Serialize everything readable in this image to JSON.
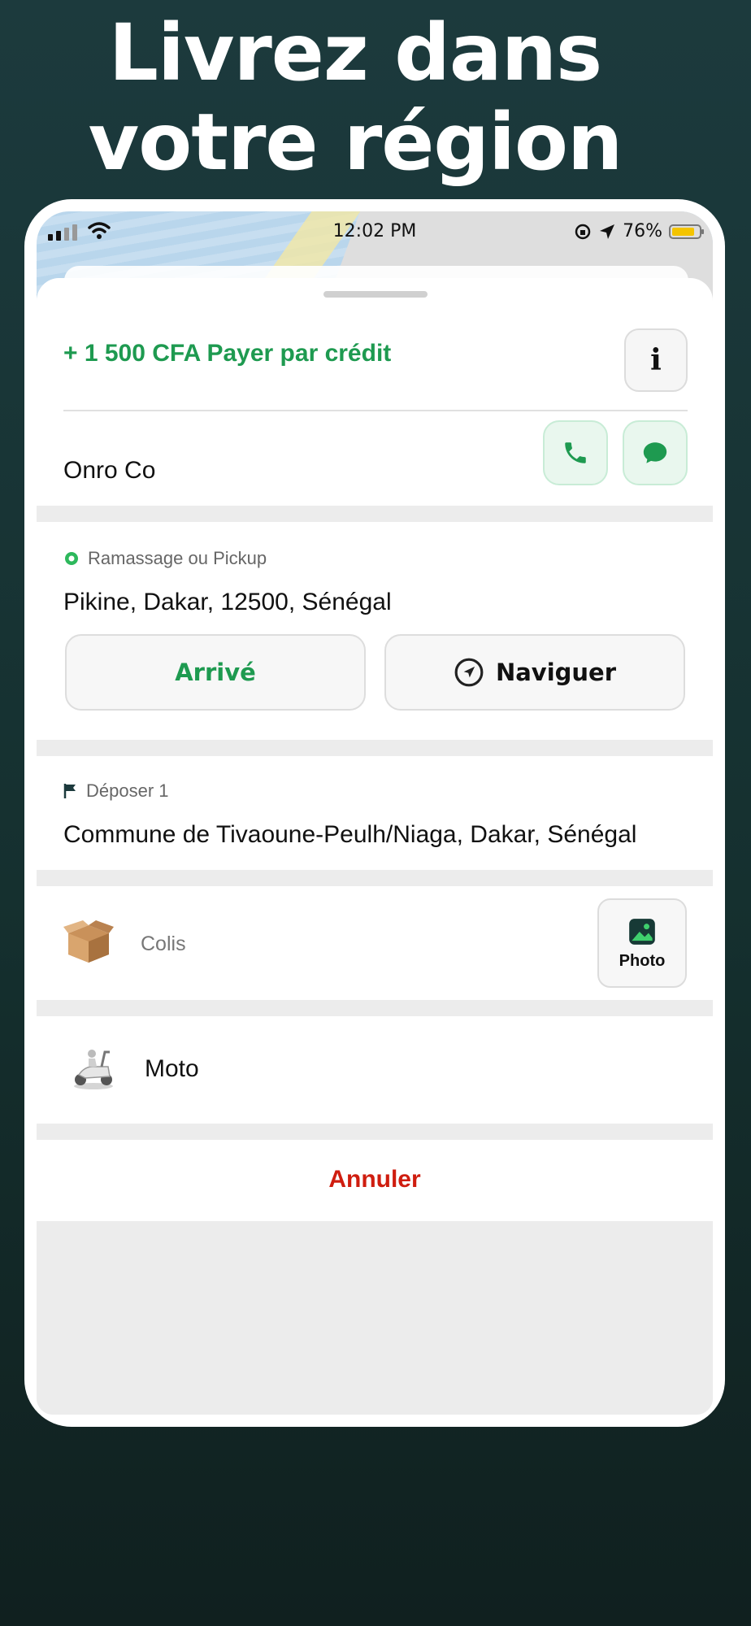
{
  "headline": {
    "line1": "Livrez dans",
    "line2": "votre région"
  },
  "status_bar": {
    "time": "12:02 PM",
    "battery": "76%"
  },
  "order": {
    "price_label": "+ 1 500 CFA Payer par crédit",
    "info_label": "i",
    "sender_name": "Onro Co"
  },
  "pickup": {
    "label": "Ramassage ou Pickup",
    "address": "Pikine, Dakar, 12500, Sénégal",
    "arrived_label": "Arrivé",
    "navigate_label": "Naviguer"
  },
  "dropoff": {
    "label": "Déposer 1",
    "address": "Commune de Tivaoune-Peulh/Niaga, Dakar, Sénégal"
  },
  "package": {
    "label": "Colis",
    "photo_label": "Photo"
  },
  "vehicle": {
    "label": "Moto"
  },
  "actions": {
    "cancel_label": "Annuler"
  },
  "colors": {
    "accent_green": "#1e9a50",
    "cancel_red": "#cf1d0f",
    "background": "#1c3a3d"
  }
}
